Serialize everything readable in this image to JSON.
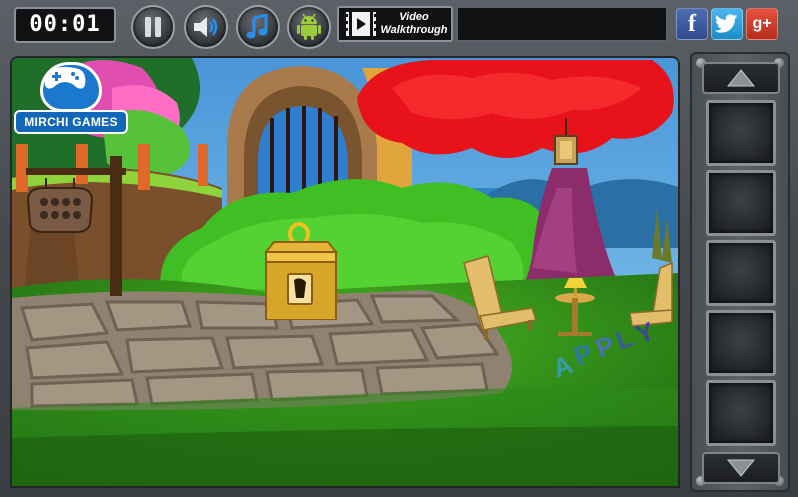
{
  "header": {
    "timer": "00:01",
    "video_walkthrough_label_line1": "Video",
    "video_walkthrough_label_line2": "Walkthrough",
    "social": {
      "facebook": "f",
      "google_plus": "g+"
    }
  },
  "icons": {
    "pause": "pause-icon",
    "sound": "speaker-icon",
    "music": "music-note-icon",
    "android": "android-icon",
    "video": "film-icon",
    "up": "arrow-up-icon",
    "down": "arrow-down-icon"
  },
  "logo": {
    "text": "MIRCHI GAMES"
  },
  "scene": {
    "ground_letters": "APPLY"
  },
  "inventory": {
    "slots": 5
  },
  "colors": {
    "frame": "#4a4e53",
    "tree_foliage": "#e8121a",
    "bush": "#35b623",
    "chest": "#d7a52a",
    "brand_blue": "#1b78cf"
  }
}
